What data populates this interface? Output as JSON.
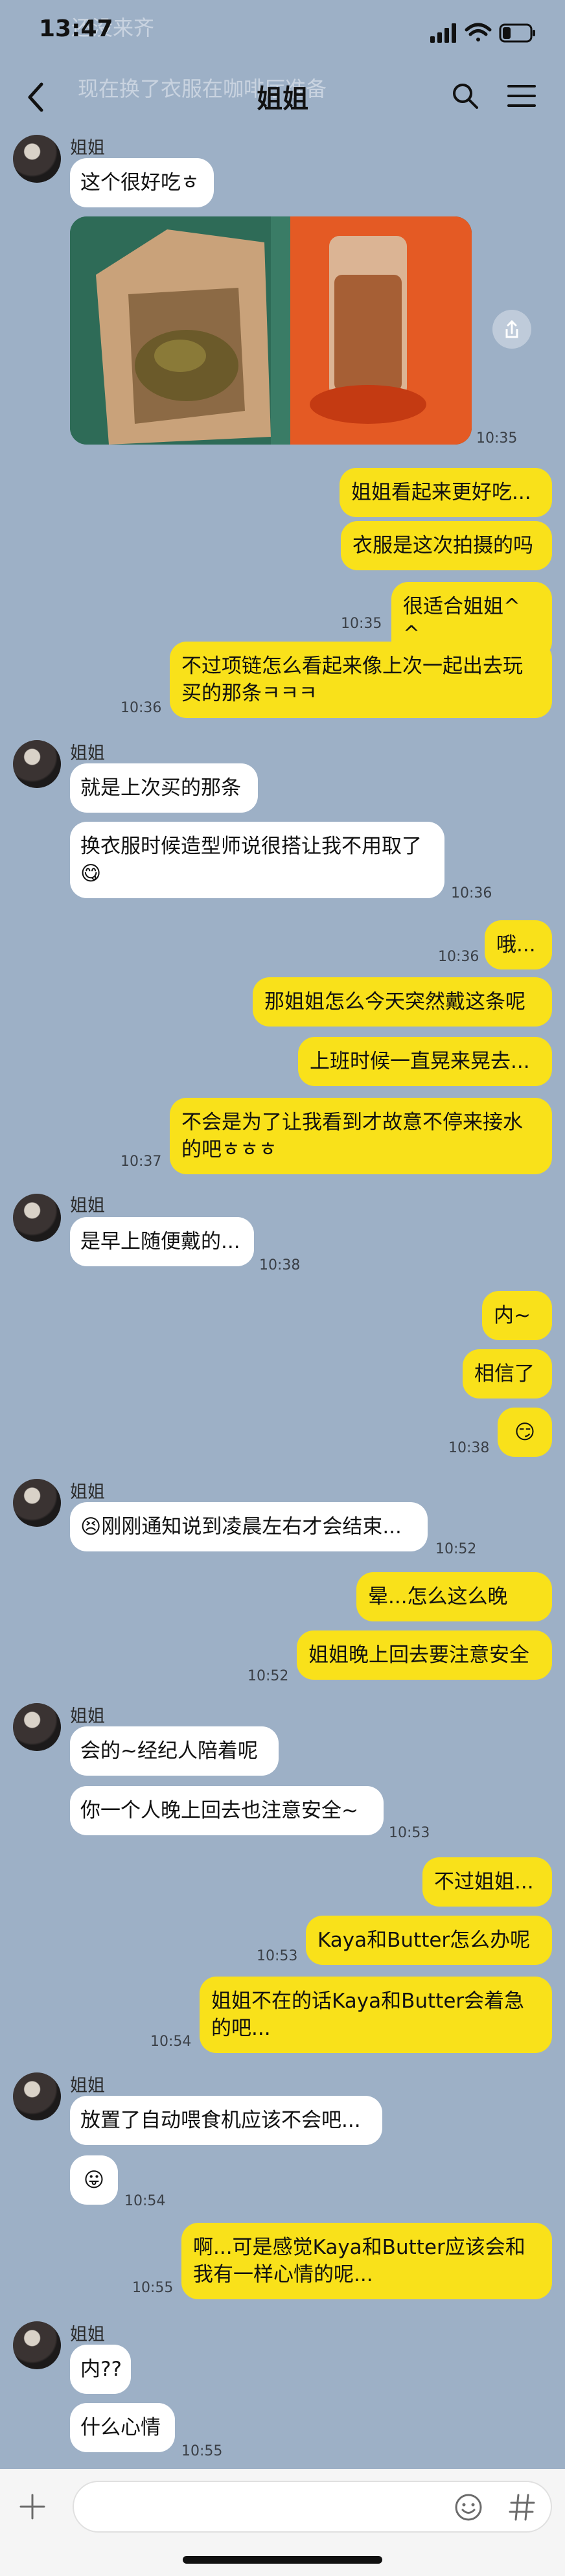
{
  "status": {
    "time": "13:47"
  },
  "ghost": {
    "line1": "还没来齐",
    "line2": "现在换了衣服在咖啡厅准备"
  },
  "header": {
    "title": "姐姐"
  },
  "messages": {
    "m1_name": "姐姐",
    "m1_text": "这个很好吃ㅎ",
    "m1_ts": "10:35",
    "o1": "姐姐看起来更好吃...",
    "o2": "衣服是这次拍摄的吗",
    "o3": "很适合姐姐^ ^",
    "o3_ts": "10:35",
    "o4a": "不过项链怎么看起来像上次一起出去玩",
    "o4b": "买的那条ㅋㅋㅋ",
    "o4_ts": "10:36",
    "m2_name": "姐姐",
    "m2_text1": "就是上次买的那条",
    "m2_text2a": "换衣服时候造型师说很搭让我不用取了",
    "m2_emoji": "😋",
    "m2_ts": "10:36",
    "o5": "哦...",
    "o5_ts": "10:36",
    "o6": "那姐姐怎么今天突然戴这条呢",
    "o7": "上班时候一直晃来晃去...",
    "o8a": "不会是为了让我看到才故意不停来接水",
    "o8b": "的吧ㅎㅎㅎ",
    "o8_ts": "10:37",
    "m3_name": "姐姐",
    "m3_text": "是早上随便戴的...",
    "m3_ts": "10:38",
    "o9": "内~",
    "o10": "相信了",
    "o11_emoji": "😏",
    "o11_ts": "10:38",
    "m4_name": "姐姐",
    "m4_emoji": "😣",
    "m4_text": "刚刚通知说到凌晨左右才会结束...",
    "m4_ts": "10:52",
    "o12": "晕...怎么这么晚",
    "o13": "姐姐晚上回去要注意安全",
    "o13_ts": "10:52",
    "m5_name": "姐姐",
    "m5_text1": "会的~经纪人陪着呢",
    "m5_text2": "你一个人晚上回去也注意安全~",
    "m5_ts": "10:53",
    "o14": "不过姐姐...",
    "o15": "Kaya和Butter怎么办呢",
    "o15_ts": "10:53",
    "o16a": "姐姐不在的话Kaya和Butter会着急",
    "o16b": "的吧...",
    "o16_ts": "10:54",
    "m6_name": "姐姐",
    "m6_text": "放置了自动喂食机应该不会吧...",
    "m6_emoji": "😛",
    "m6_ts": "10:54",
    "o17a": "啊...可是感觉Kaya和Butter应该会和",
    "o17b": "我有一样心情的呢...",
    "o17_ts": "10:55",
    "m7_name": "姐姐",
    "m7_text1": "内??",
    "m7_text2": "什么心情",
    "m7_ts": "10:55"
  },
  "icons": {
    "back": "chevron-left-icon",
    "search": "search-icon",
    "menu": "hamburger-menu-icon",
    "share": "share-icon",
    "plus": "plus-icon",
    "emoji": "emoji-icon",
    "hash": "hashtag-icon"
  },
  "colors": {
    "background": "#9db0c6",
    "outgoing": "#f9e11a",
    "incoming": "#ffffff"
  }
}
